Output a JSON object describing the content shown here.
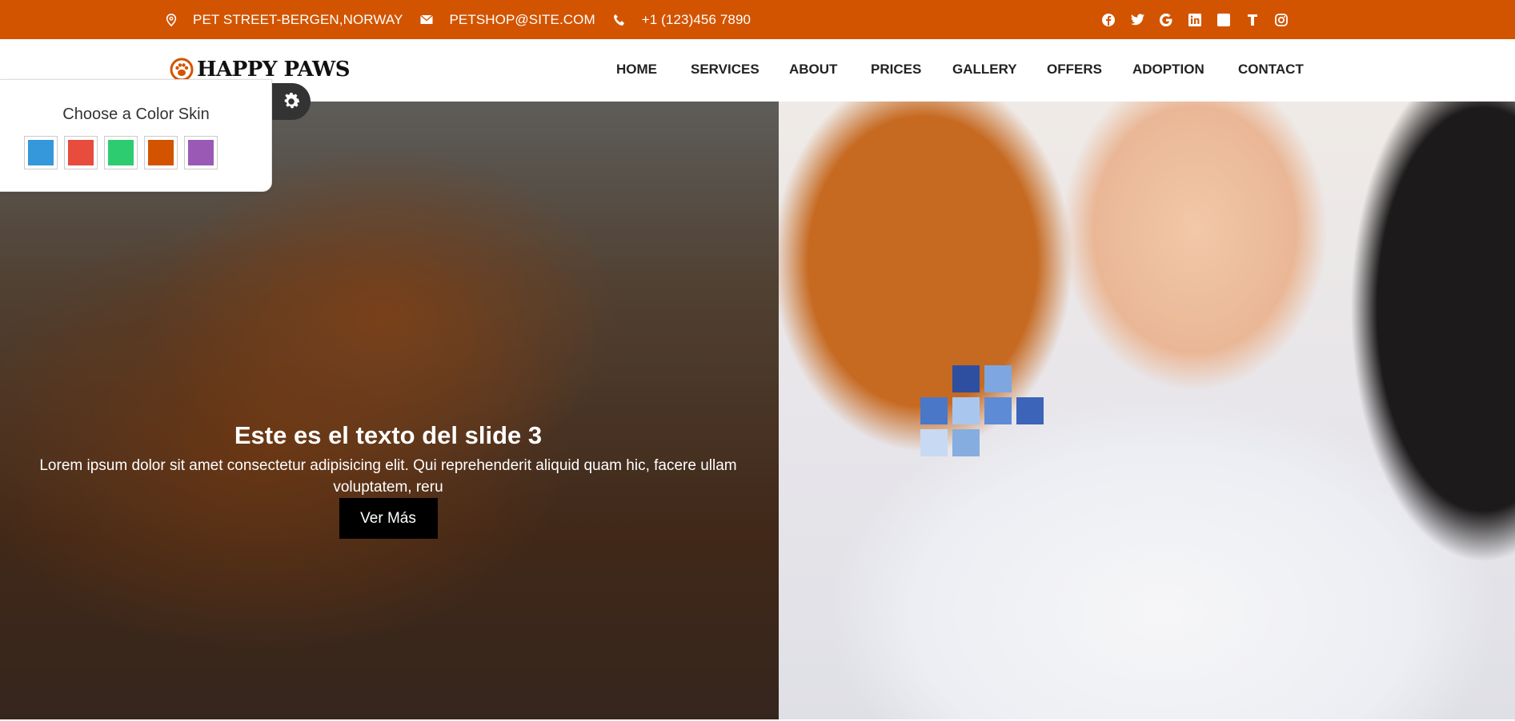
{
  "topbar": {
    "address": "PET STREET-BERGEN,NORWAY",
    "email": "PETSHOP@SITE.COM",
    "phone": "+1 (123)456 7890",
    "address_icon": "location-pin-icon",
    "email_icon": "envelope-icon",
    "phone_icon": "phone-icon",
    "social": [
      "facebook-icon",
      "twitter-icon",
      "google-icon",
      "linkedin-icon",
      "square-icon",
      "text-icon",
      "instagram-icon"
    ]
  },
  "brand": {
    "name": "HAPPY PAWS",
    "logo_icon": "paw-icon"
  },
  "nav": {
    "items": [
      "HOME",
      "SERVICES",
      "ABOUT",
      "PRICES",
      "GALLERY",
      "OFFERS",
      "ADOPTION",
      "CONTACT"
    ]
  },
  "hero": {
    "title": "Este es el texto del slide 3",
    "text": "Lorem ipsum dolor sit amet consectetur adipisicing elit. Qui reprehenderit aliquid quam hic, facere ullam voluptatem, reru",
    "button": "Ver Más"
  },
  "skin_panel": {
    "title": "Choose a Color Skin",
    "toggle_icon": "gear-icon",
    "colors": [
      "#3498db",
      "#e74c3c",
      "#2ecc71",
      "#d35400",
      "#9b59b6"
    ]
  },
  "colors": {
    "accent": "#d35400",
    "topbar_text": "#ffffff",
    "button_bg": "#000000"
  }
}
